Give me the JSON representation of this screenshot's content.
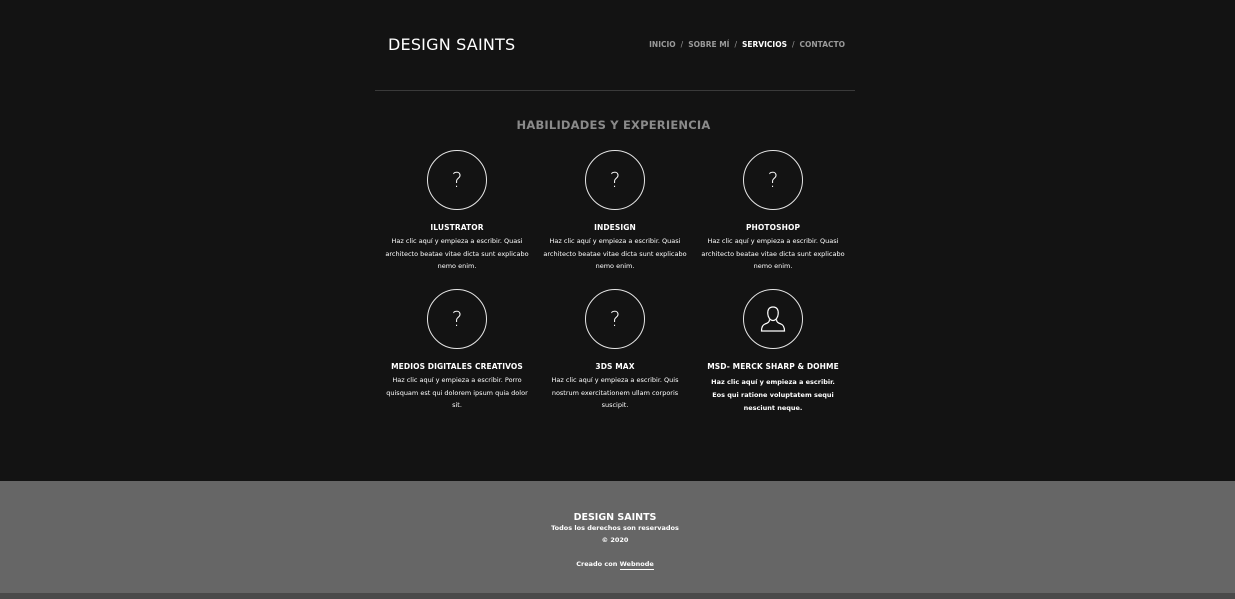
{
  "header": {
    "logo": "DESIGN SAINTS",
    "nav": [
      {
        "label": "INICIO",
        "active": false
      },
      {
        "label": "SOBRE MÍ",
        "active": false
      },
      {
        "label": "SERVICIOS",
        "active": true
      },
      {
        "label": "CONTACTO",
        "active": false
      }
    ],
    "separator": "/"
  },
  "section": {
    "title": "HABILIDADES Y EXPERIENCIA"
  },
  "skills": [
    {
      "icon": "question-icon",
      "glyph": "?",
      "title": "ILUSTRATOR",
      "text": "Haz clic aquí y empieza a escribir. Quasi architecto beatae vitae dicta sunt explicabo nemo enim."
    },
    {
      "icon": "question-icon",
      "glyph": "?",
      "title": "INDESIGN",
      "text": "Haz clic aquí y empieza a escribir. Quasi architecto beatae vitae dicta sunt explicabo nemo enim."
    },
    {
      "icon": "question-icon",
      "glyph": "?",
      "title": "PHOTOSHOP",
      "text": "Haz clic aquí y empieza a escribir. Quasi architecto beatae vitae dicta sunt explicabo nemo enim."
    },
    {
      "icon": "question-icon",
      "glyph": "?",
      "title": "MEDIOS DIGITALES CREATIVOS",
      "text": "Haz clic aquí y empieza a escribir. Porro quisquam est qui dolorem ipsum quia dolor sit."
    },
    {
      "icon": "question-icon",
      "glyph": "?",
      "title": "3DS MAX",
      "text": "Haz clic aquí y empieza a escribir. Quis nostrum exercitationem ullam corporis suscipit."
    },
    {
      "icon": "user-icon",
      "glyph": "",
      "title": "MSD- MERCK SHARP & DOHME",
      "text": "Haz clic aquí y empieza a escribir. Eos qui ratione voluptatem sequi nesciunt neque."
    }
  ],
  "footer": {
    "brand": "DESIGN SAINTS",
    "rights": "Todos los derechos son reservados",
    "copyright": "© 2020",
    "created_prefix": "Creado con",
    "created_link": "Webnode"
  },
  "colors": {
    "background": "#131313",
    "footer": "#666666",
    "nav_inactive": "#9a9a9a",
    "title_gray": "#8a8a8a"
  }
}
